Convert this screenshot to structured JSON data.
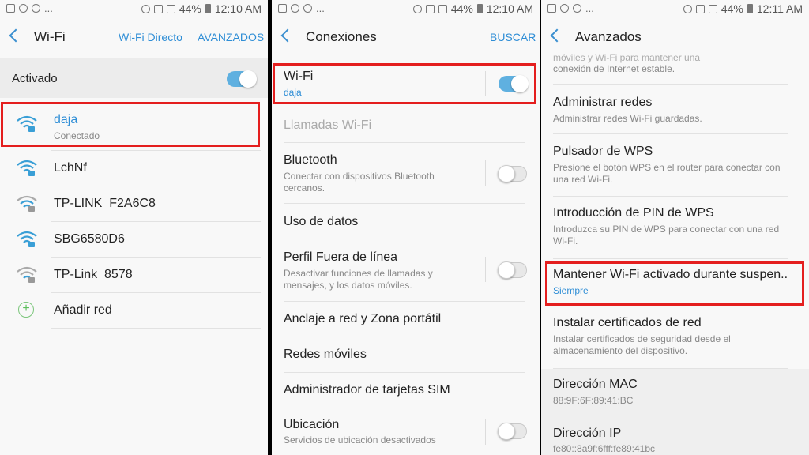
{
  "status_bars": [
    {
      "time": "12:10 AM",
      "battery": "44%",
      "left_extra": "..."
    },
    {
      "time": "12:10 AM",
      "battery": "44%",
      "left_extra": "..."
    },
    {
      "time": "12:11 AM",
      "battery": "44%",
      "left_extra": "..."
    }
  ],
  "wifi_screen": {
    "title": "Wi-Fi",
    "action_direct": "Wi-Fi Directo",
    "action_advanced": "AVANZADOS",
    "activated_label": "Activado",
    "networks": [
      {
        "name": "daja",
        "status": "Conectado"
      },
      {
        "name": "LchNf"
      },
      {
        "name": "TP-LINK_F2A6C8"
      },
      {
        "name": "SBG6580D6"
      },
      {
        "name": "TP-Link_8578"
      }
    ],
    "add_network": "Añadir red"
  },
  "connections_screen": {
    "title": "Conexiones",
    "action_search": "BUSCAR",
    "items": [
      {
        "label": "Wi-Fi",
        "sub": "daja"
      },
      {
        "label": "Llamadas Wi-Fi"
      },
      {
        "label": "Bluetooth",
        "sub": "Conectar con dispositivos Bluetooth cercanos."
      },
      {
        "label": "Uso de datos"
      },
      {
        "label": "Perfil Fuera de línea",
        "sub": "Desactivar funciones de llamadas y mensajes, y los datos móviles."
      },
      {
        "label": "Anclaje a red y Zona portátil"
      },
      {
        "label": "Redes móviles"
      },
      {
        "label": "Administrador de tarjetas SIM"
      },
      {
        "label": "Ubicación",
        "sub": "Servicios de ubicación desactivados"
      }
    ]
  },
  "advanced_screen": {
    "title": "Avanzados",
    "top_cut_text": "conexión de Internet estable.",
    "top_cut_partial": "móviles y Wi-Fi para mantener una",
    "items": [
      {
        "label": "Administrar redes",
        "sub": "Administrar redes Wi-Fi guardadas."
      },
      {
        "label": "Pulsador de WPS",
        "sub": "Presione el botón WPS en el router para conectar con una red Wi-Fi."
      },
      {
        "label": "Introducción de PIN de WPS",
        "sub": "Introduzca su PIN de WPS para conectar con una red Wi-Fi."
      },
      {
        "label": "Mantener Wi-Fi activado durante suspen..",
        "sub": "Siempre"
      },
      {
        "label": "Instalar certificados de red",
        "sub": "Instalar certificados de seguridad desde el almacenamiento del dispositivo."
      },
      {
        "label": "Dirección MAC",
        "sub": "88:9F:6F:89:41:BC"
      },
      {
        "label": "Dirección IP",
        "sub": "fe80::8a9f:6fff:fe89:41bc"
      }
    ]
  },
  "colors": {
    "accent": "#2f8ed6",
    "highlight": "#e41e1e",
    "toggle_on": "#5fb0e0"
  }
}
